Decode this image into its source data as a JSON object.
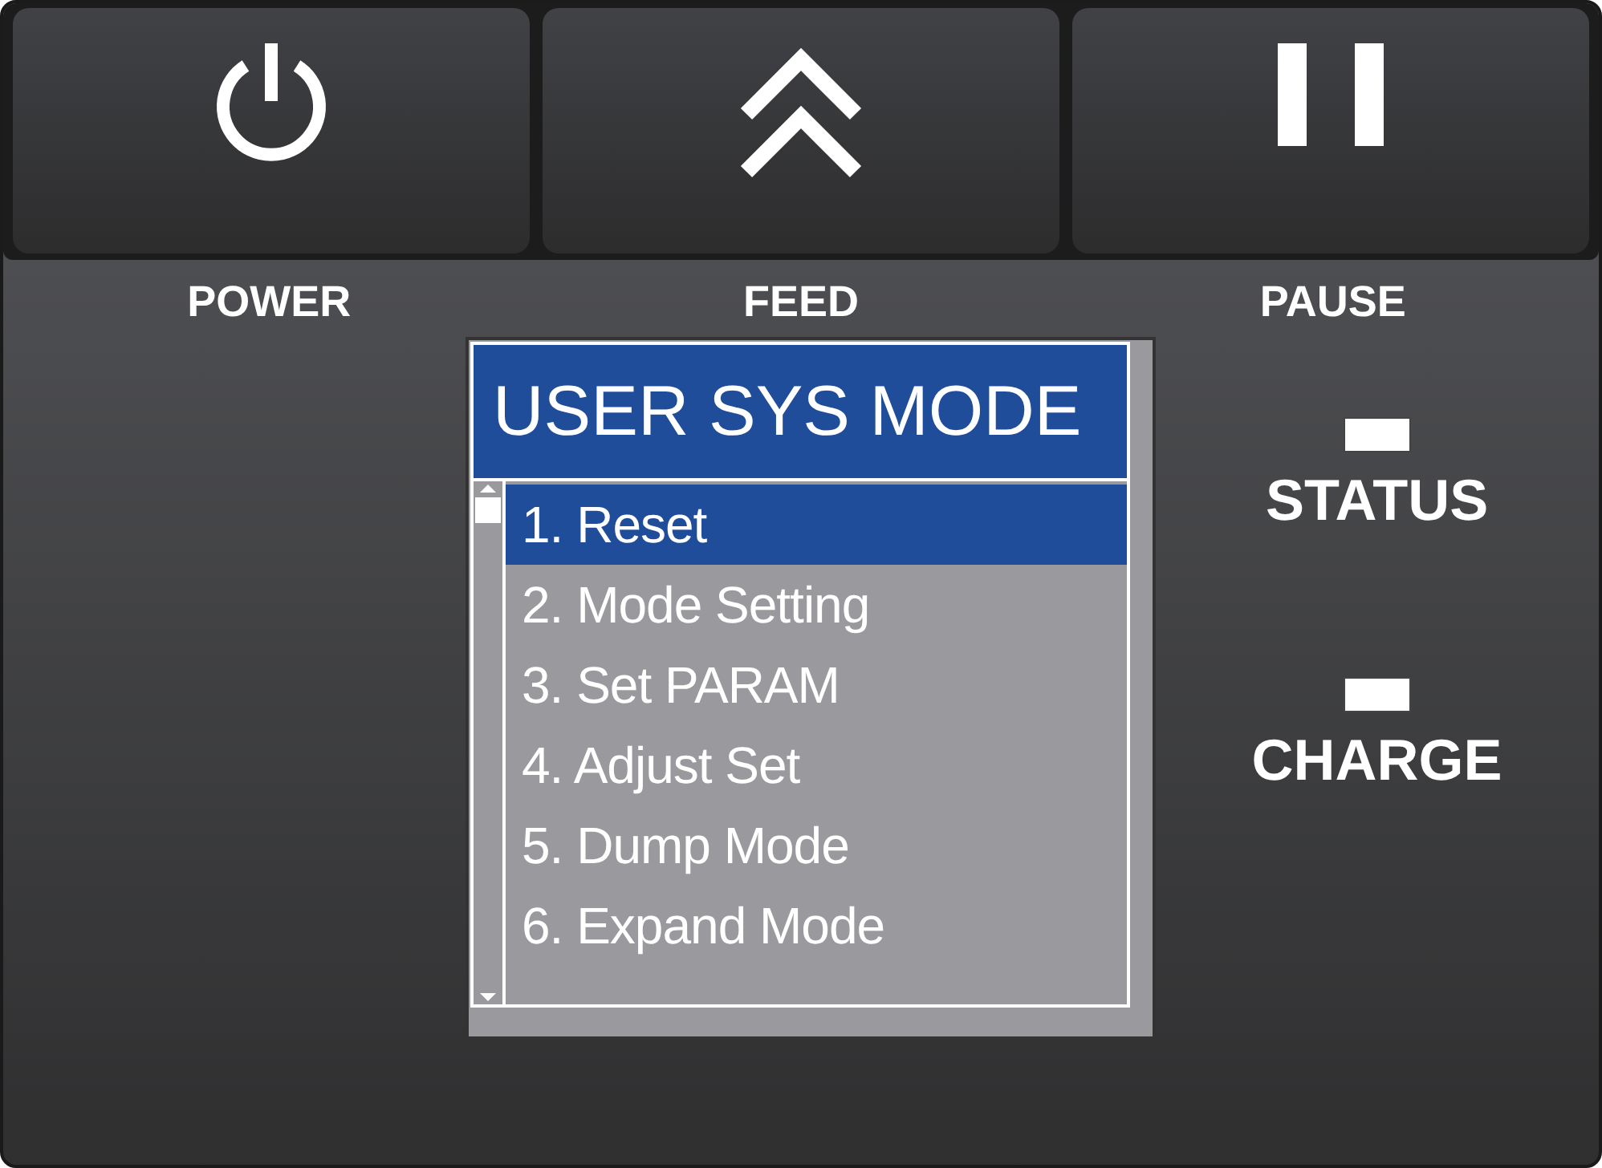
{
  "buttons": [
    {
      "kind": "power",
      "label": "POWER"
    },
    {
      "kind": "feed",
      "label": "FEED"
    },
    {
      "kind": "pause",
      "label": "PAUSE"
    }
  ],
  "screen": {
    "title": "USER SYS MODE",
    "menu": [
      {
        "label": "1. Reset",
        "selected": true
      },
      {
        "label": "2. Mode Setting",
        "selected": false
      },
      {
        "label": "3. Set PARAM",
        "selected": false
      },
      {
        "label": "4. Adjust Set",
        "selected": false
      },
      {
        "label": "5. Dump Mode",
        "selected": false
      },
      {
        "label": "6. Expand Mode",
        "selected": false
      }
    ]
  },
  "indicators": [
    {
      "label": "STATUS"
    },
    {
      "label": "CHARGE"
    }
  ]
}
